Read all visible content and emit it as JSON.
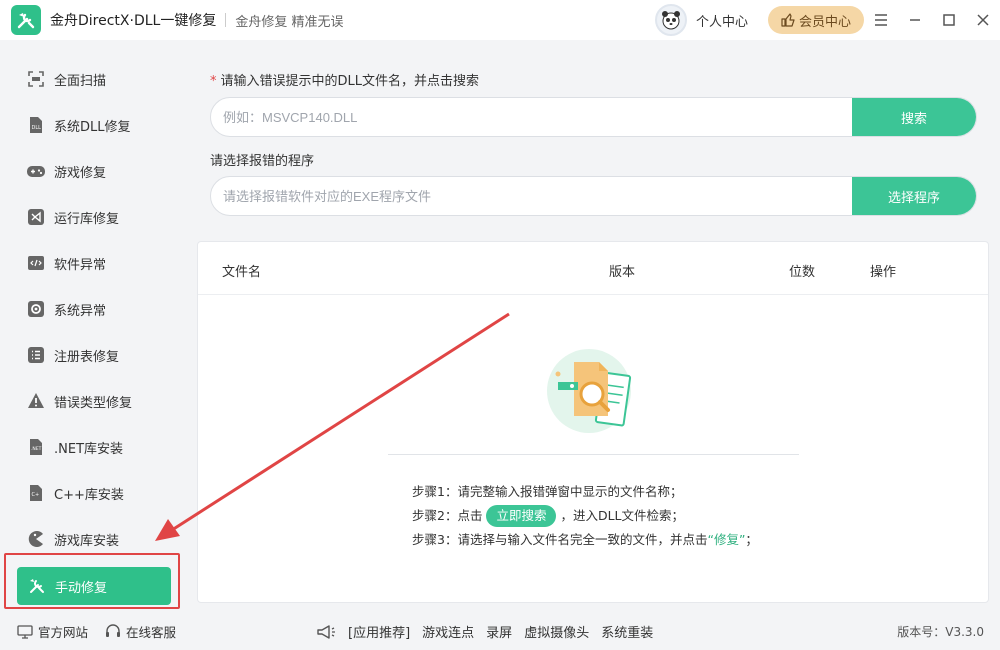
{
  "titlebar": {
    "app_title": "金舟DirectX·DLL一键修复",
    "slogan": "金舟修复 精准无误",
    "user_center": "个人中心",
    "vip_center": "会员中心"
  },
  "sidebar": {
    "items": [
      {
        "label": "全面扫描",
        "icon": "scan-icon"
      },
      {
        "label": "系统DLL修复",
        "icon": "dll-icon"
      },
      {
        "label": "游戏修复",
        "icon": "gamepad-icon"
      },
      {
        "label": "运行库修复",
        "icon": "visual-studio-icon"
      },
      {
        "label": "软件异常",
        "icon": "code-icon"
      },
      {
        "label": "系统异常",
        "icon": "gear-icon"
      },
      {
        "label": "注册表修复",
        "icon": "list-icon"
      },
      {
        "label": "错误类型修复",
        "icon": "warning-icon"
      },
      {
        "label": ".NET库安装",
        "icon": "dotnet-icon"
      },
      {
        "label": "C++库安装",
        "icon": "cpp-icon"
      },
      {
        "label": "游戏库安装",
        "icon": "pacman-icon"
      }
    ],
    "active_label": "手动修复"
  },
  "main": {
    "dll_label": "请输入错误提示中的DLL文件名，并点击搜索",
    "dll_required_mark": "*",
    "dll_placeholder": "例如：MSVCP140.DLL",
    "search_button": "搜索",
    "prog_label": "请选择报错的程序",
    "prog_placeholder": "请选择报错软件对应的EXE程序文件",
    "select_button": "选择程序",
    "table": {
      "headers": [
        "文件名",
        "版本",
        "位数",
        "操作"
      ]
    },
    "steps": {
      "step1": "步骤1：请完整输入报错弹窗中显示的文件名称；",
      "step2_prefix": "步骤2：点击",
      "step2_button": "立即搜索",
      "step2_suffix": "，进入DLL文件检索；",
      "step3_prefix": "步骤3：请选择与输入文件名完全一致的文件，并点击",
      "step3_highlight": "“修复”",
      "step3_suffix": "；"
    }
  },
  "footer": {
    "website": "官方网站",
    "support": "在线客服",
    "recommend": "[应用推荐]",
    "links": [
      "游戏连点",
      "录屏",
      "虚拟摄像头",
      "系统重装"
    ],
    "version": "版本号：V3.3.0"
  },
  "colors": {
    "accent": "#3cc596",
    "active_bg": "#2fc08a",
    "annotation_red": "#e04545",
    "vip_bg": "#f5d7a6"
  }
}
